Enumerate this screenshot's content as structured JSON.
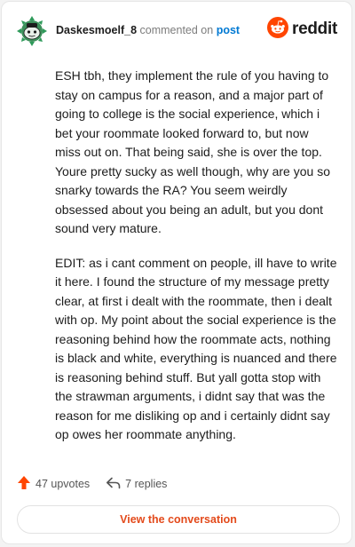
{
  "comment": {
    "author": "Daskesmoelf_8",
    "action_text": "commented on",
    "post_link": "post",
    "brand": "reddit",
    "paragraphs": [
      "ESH tbh, they implement the rule of you having to stay on campus for a reason, and a major part of going to college is the social experience, which i bet your roommate looked forward to, but now miss out on. That being said, she is over the top. Youre pretty sucky as well though, why are you so snarky towards the RA? You seem weirdly obsessed about you being an adult, but you dont sound very mature.",
      "EDIT: as i cant comment on people, ill have to write it here. I found the structure of my message pretty clear, at first i dealt with the roommate, then i dealt with op. My point about the social experience is the reasoning behind how the roommate acts, nothing is black and white, everything is nuanced and there is reasoning behind stuff. But yall gotta stop with the strawman arguments, i didnt say that was the reason for me disliking op and i certainly didnt say op owes her roommate anything."
    ],
    "upvotes": "47 upvotes",
    "replies": "7 replies",
    "view_button": "View the conversation"
  },
  "colors": {
    "accent": "#ff4500",
    "link": "#0079d3",
    "button_text": "#e34a1b",
    "upvote_arrow": "#ff4500"
  },
  "icons": {
    "avatar": "snoo-avatar-icon",
    "brand": "reddit-logo-icon",
    "upvote": "upvote-arrow-icon",
    "reply": "reply-arrow-icon"
  }
}
